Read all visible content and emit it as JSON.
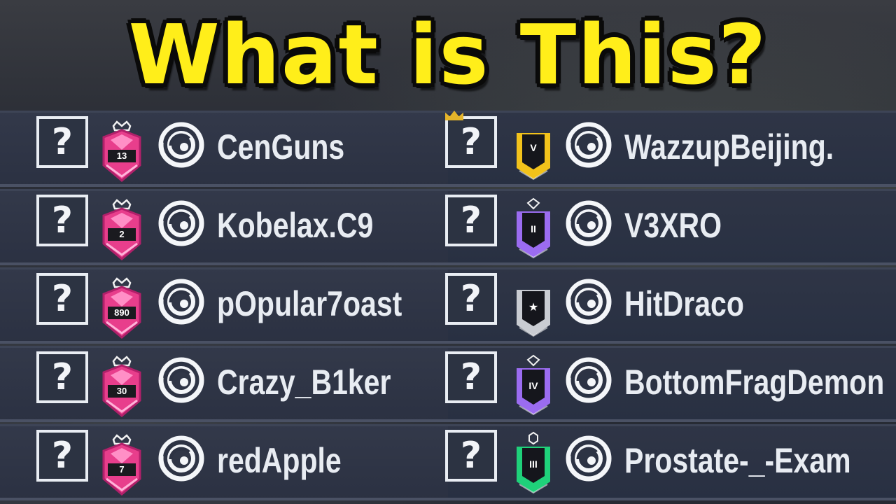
{
  "title": "What is This?",
  "left_players": [
    {
      "name": "CenGuns",
      "operator": "?",
      "rank": "champion",
      "rank_number": "13",
      "platform_icon": "ubisoft-icon"
    },
    {
      "name": "Kobelax.C9",
      "operator": "?",
      "rank": "champion",
      "rank_number": "2",
      "platform_icon": "ubisoft-icon"
    },
    {
      "name": "pOpular7oast",
      "operator": "?",
      "rank": "champion",
      "rank_number": "890",
      "platform_icon": "ubisoft-icon"
    },
    {
      "name": "Crazy_B1ker",
      "operator": "?",
      "rank": "champion",
      "rank_number": "30",
      "platform_icon": "ubisoft-icon"
    },
    {
      "name": "redApple",
      "operator": "?",
      "rank": "champion",
      "rank_number": "7",
      "platform_icon": "ubisoft-icon"
    }
  ],
  "right_players": [
    {
      "name": "WazzupBeijing.",
      "operator": "?",
      "rank": "gold",
      "rank_number": "V",
      "platform_icon": "ubisoft-icon"
    },
    {
      "name": "V3XRO",
      "operator": "?",
      "rank": "diamond",
      "rank_number": "II",
      "platform_icon": "ubisoft-icon"
    },
    {
      "name": "HitDraco",
      "operator": "?",
      "rank": "unranked",
      "rank_number": "",
      "platform_icon": "ubisoft-icon"
    },
    {
      "name": "BottomFragDemon",
      "operator": "?",
      "rank": "diamond",
      "rank_number": "IV",
      "platform_icon": "ubisoft-icon"
    },
    {
      "name": "Prostate-_-Exam",
      "operator": "?",
      "rank": "emerald",
      "rank_number": "III",
      "platform_icon": "ubisoft-icon"
    }
  ],
  "colors": {
    "title": "#ffee1a",
    "champion": "#e83e8c",
    "gold": "#f2c21b",
    "diamond": "#9b6cf0",
    "emerald": "#1fd17a",
    "unranked": "#c9ccd2"
  }
}
